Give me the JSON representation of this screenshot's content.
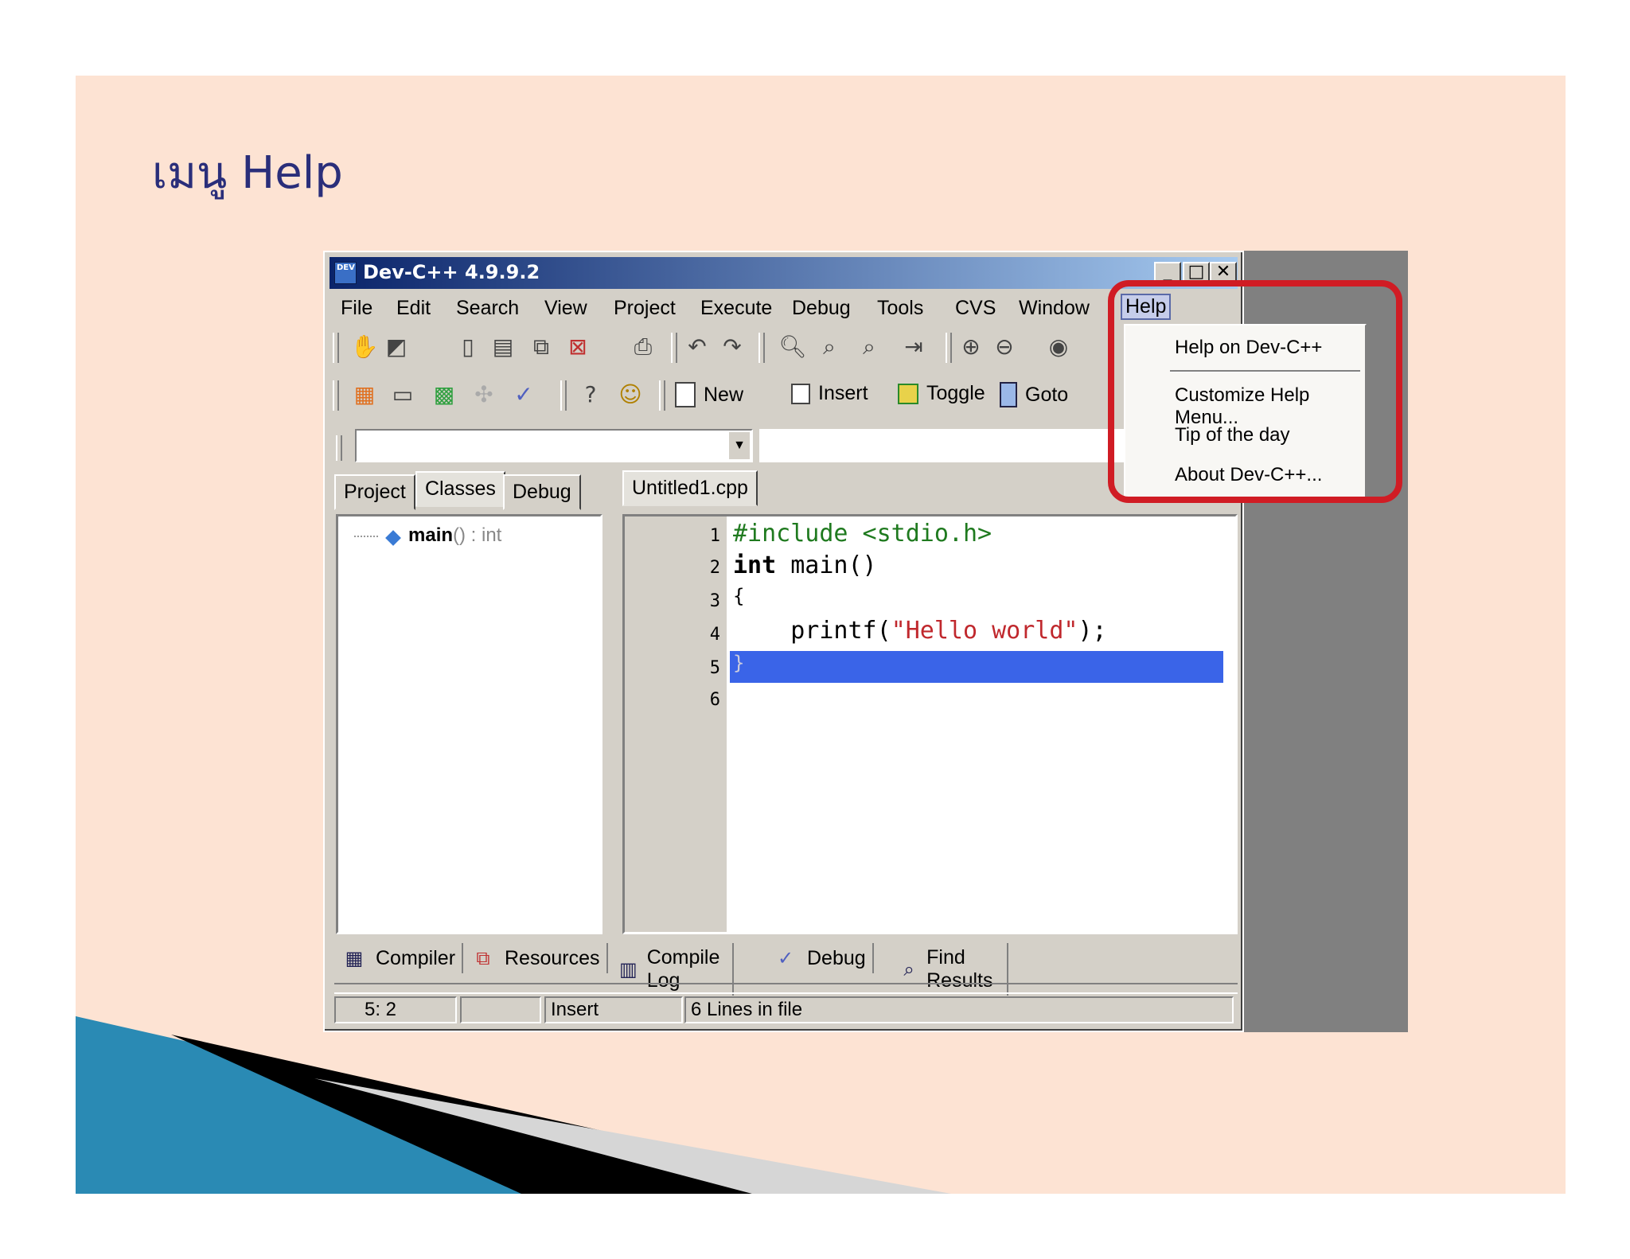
{
  "slide": {
    "title": "เมนู Help"
  },
  "window": {
    "title": "Dev-C++ 4.9.9.2",
    "min": "_",
    "max": "□",
    "close": "✕"
  },
  "menubar": [
    {
      "label": "File"
    },
    {
      "label": "Edit"
    },
    {
      "label": "Search"
    },
    {
      "label": "View"
    },
    {
      "label": "Project"
    },
    {
      "label": "Execute"
    },
    {
      "label": "Debug"
    },
    {
      "label": "Tools"
    },
    {
      "label": "CVS"
    },
    {
      "label": "Window"
    },
    {
      "label": "Help"
    }
  ],
  "toolbar": {
    "new_label": "New",
    "insert_label": "Insert",
    "toggle_label": "Toggle",
    "goto_label": "Goto"
  },
  "left_tabs": [
    {
      "label": "Project"
    },
    {
      "label": "Classes"
    },
    {
      "label": "Debug"
    }
  ],
  "class_tree": {
    "name": "main",
    "signature": "() : int"
  },
  "editor": {
    "tab": "Untitled1.cpp",
    "line_numbers": [
      "1",
      "2",
      "3",
      "4",
      "5",
      "6"
    ],
    "lines": [
      "#include <stdio.h>",
      "int main()",
      "{",
      "    printf(",
      "\"Hello world\"",
      ");",
      "}"
    ],
    "keyword": "int",
    "selected_line": 5
  },
  "bottom_tabs": [
    {
      "label": "Compiler"
    },
    {
      "label": "Resources"
    },
    {
      "label": "Compile Log"
    },
    {
      "label": "Debug"
    },
    {
      "label": "Find Results"
    }
  ],
  "status": {
    "position": "5: 2",
    "blank": "",
    "mode": "Insert",
    "lines": "6 Lines in file"
  },
  "help_menu": [
    {
      "label": "Help on Dev-C++"
    },
    {
      "label": "Customize Help Menu..."
    },
    {
      "label": "Tip of the day"
    },
    {
      "label": "About Dev-C++..."
    }
  ],
  "colors": {
    "highlight_box": "#d01c24",
    "selection": "#3a64e8",
    "title_text": "#2a2e7a",
    "string": "#c0282d",
    "preprocessor": "#1f7a1f"
  }
}
